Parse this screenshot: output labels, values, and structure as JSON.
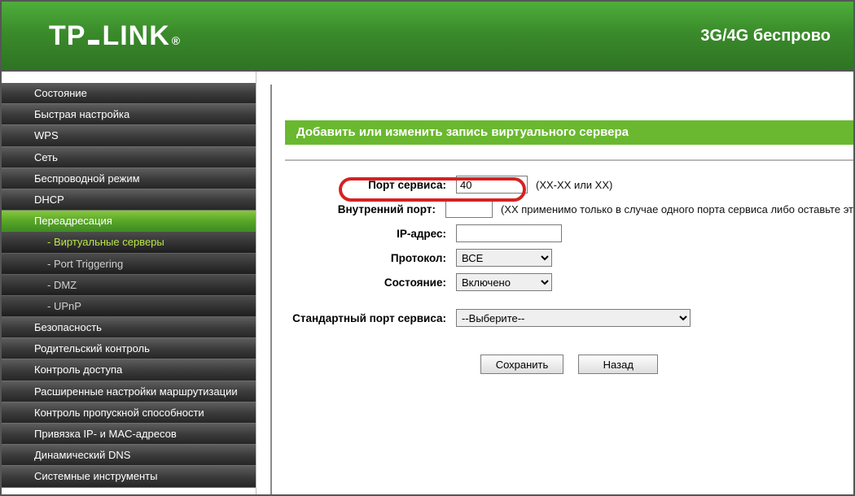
{
  "header": {
    "brand_a": "TP",
    "brand_b": "LINK",
    "title": "3G/4G беспрово"
  },
  "sidebar": {
    "items": [
      {
        "label": "Состояние"
      },
      {
        "label": "Быстрая настройка"
      },
      {
        "label": "WPS"
      },
      {
        "label": "Сеть"
      },
      {
        "label": "Беспроводной режим"
      },
      {
        "label": "DHCP"
      },
      {
        "label": "Переадресация",
        "active": true
      },
      {
        "label": "Безопасность"
      },
      {
        "label": "Родительский контроль"
      },
      {
        "label": "Контроль доступа"
      },
      {
        "label": "Расширенные настройки маршрутизации"
      },
      {
        "label": "Контроль пропускной способности"
      },
      {
        "label": "Привязка IP- и MAC-адресов"
      },
      {
        "label": "Динамический DNS"
      },
      {
        "label": "Системные инструменты"
      }
    ],
    "sub": [
      {
        "label": "- Виртуальные серверы",
        "selected": true
      },
      {
        "label": "- Port Triggering"
      },
      {
        "label": "- DMZ"
      },
      {
        "label": "- UPnP"
      }
    ]
  },
  "page": {
    "title": "Добавить или изменить запись виртуального сервера",
    "labels": {
      "service_port": "Порт сервиса:",
      "internal_port": "Внутренний порт:",
      "ip": "IP-адрес:",
      "protocol": "Протокол:",
      "status": "Состояние:",
      "std_port": "Стандартный порт сервиса:"
    },
    "values": {
      "service_port": "40",
      "internal_port": "",
      "ip": "",
      "protocol": "ВСЕ",
      "status": "Включено",
      "std_port": "--Выберите--"
    },
    "hints": {
      "service_port": "(XX-XX или XX)",
      "internal_port": "(XX применимо только в случае одного порта сервиса либо оставьте эт"
    },
    "buttons": {
      "save": "Сохранить",
      "back": "Назад"
    }
  }
}
